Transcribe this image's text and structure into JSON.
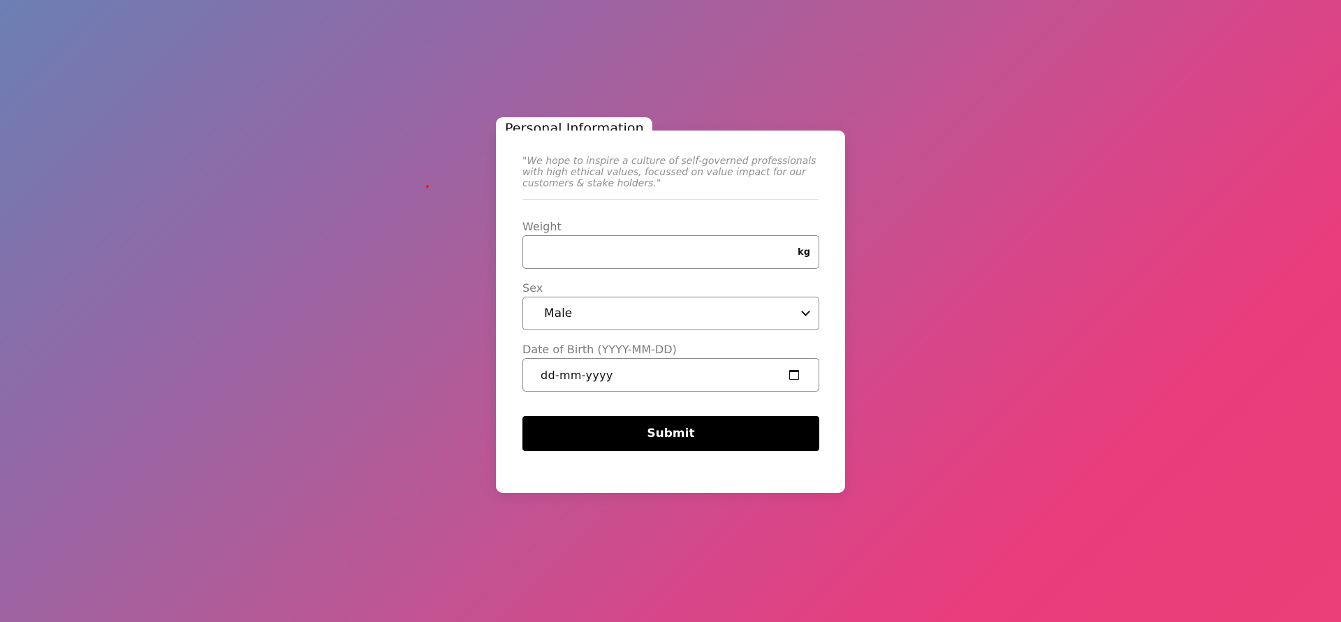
{
  "form": {
    "title": "Personal Information",
    "quote": "\"We hope to inspire a culture of self-governed professionals with high ethical values, focussed on value impact for our customers & stake holders.\"",
    "weight": {
      "label": "Weight",
      "value": "",
      "unit": "kg"
    },
    "sex": {
      "label": "Sex",
      "selected": "Male"
    },
    "dob": {
      "label": "Date of Birth (YYYY-MM-DD)",
      "placeholder": "dd-mm-yyyy"
    },
    "submit_label": "Submit"
  },
  "colors": {
    "gradient_start": "#6b80b4",
    "gradient_end": "#ea3f78",
    "button_bg": "#000000",
    "button_text": "#ffffff",
    "card_bg": "#ffffff"
  },
  "icons": {
    "select_arrow": "chevron-down-icon",
    "date_picker": "calendar-icon"
  }
}
